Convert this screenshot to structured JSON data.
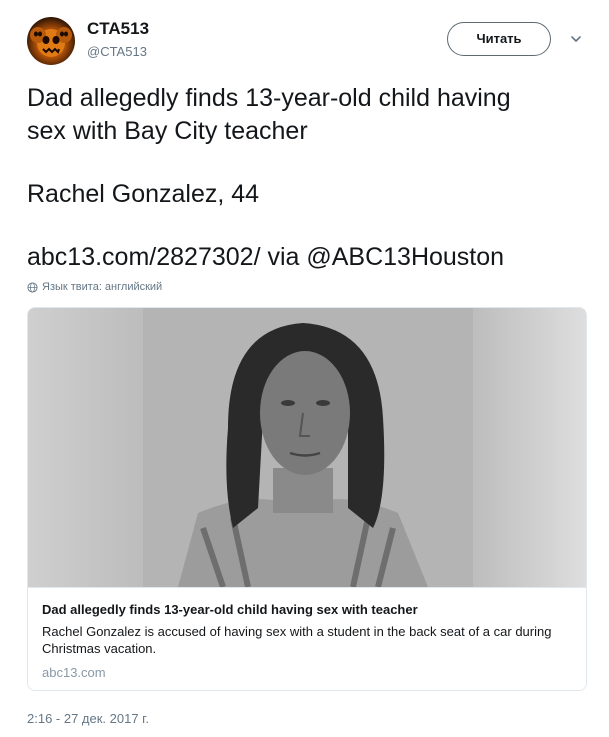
{
  "author": {
    "display_name": "CTA513",
    "handle": "@CTA513",
    "avatar_icon": "pumpkin-skulls-avatar"
  },
  "follow_button_label": "Читать",
  "tweet": {
    "lines": [
      "Dad allegedly finds 13-year-old child having",
      "sex with Bay City teacher",
      "Rachel Gonzalez, 44",
      "abc13.com/2827302/ via @ABC13Houston"
    ],
    "language_note": "Язык твита: английский"
  },
  "card": {
    "title": "Dad allegedly finds 13-year-old child having sex with teacher",
    "description": "Rachel Gonzalez is accused of having sex with a student in the back seat of a car during Christmas vacation.",
    "domain": "abc13.com"
  },
  "timestamp": "2:16 - 27 дек. 2017 г.",
  "colors": {
    "text_primary": "#14171a",
    "text_secondary": "#657786",
    "border": "#e1e8ed"
  }
}
